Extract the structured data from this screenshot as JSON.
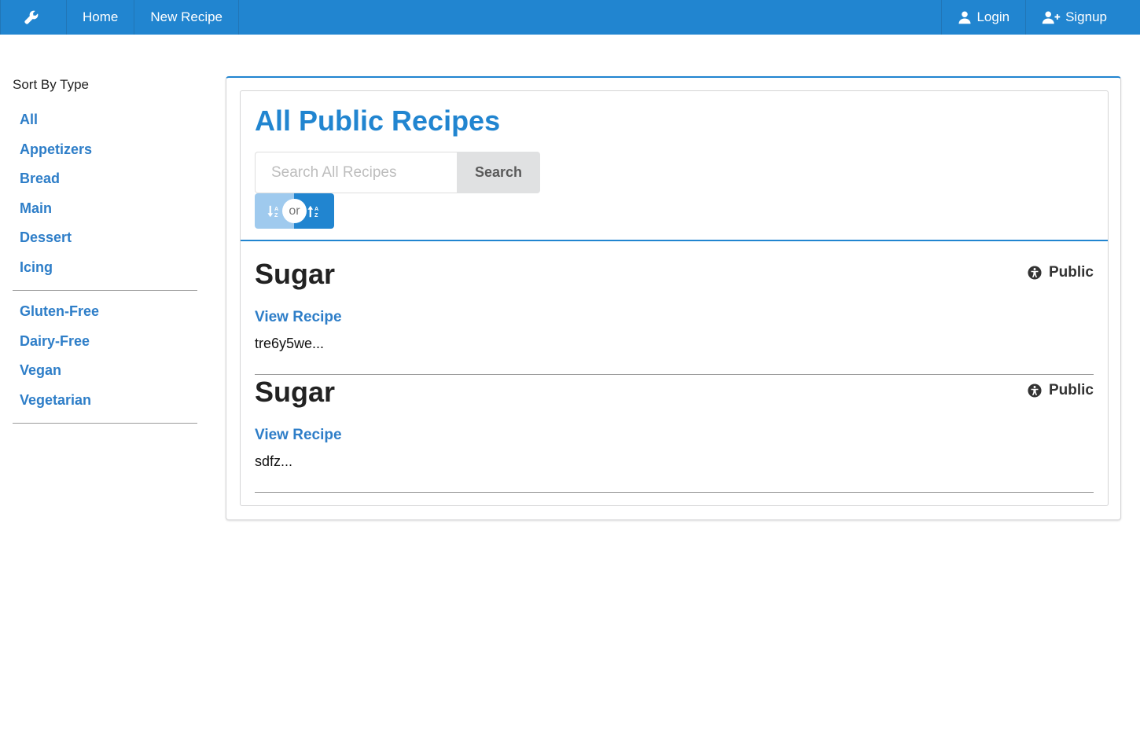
{
  "nav": {
    "logo_icon": "wrench-icon",
    "home": "Home",
    "new_recipe": "New Recipe",
    "login": "Login",
    "signup": "Signup",
    "color": "#2185d0"
  },
  "sidebar": {
    "heading": "Sort By Type",
    "types": [
      "All",
      "Appetizers",
      "Bread",
      "Main",
      "Dessert",
      "Icing"
    ],
    "diets": [
      "Gluten-Free",
      "Dairy-Free",
      "Vegan",
      "Vegetarian"
    ]
  },
  "main": {
    "title": "All Public Recipes",
    "search": {
      "placeholder": "Search All Recipes",
      "value": "",
      "button": "Search"
    },
    "sort": {
      "or_label": "or",
      "desc_icon": "sort-alpha-down-icon",
      "asc_icon": "sort-alpha-up-icon"
    },
    "recipes": [
      {
        "title": "Sugar",
        "visibility": "Public",
        "link": "View Recipe",
        "description": "tre6y5we..."
      },
      {
        "title": "Sugar",
        "visibility": "Public",
        "link": "View Recipe",
        "description": "sdfz..."
      }
    ]
  }
}
